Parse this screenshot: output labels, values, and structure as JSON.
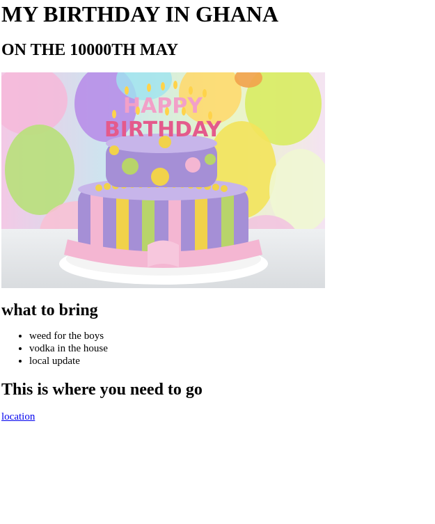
{
  "header": {
    "title": "MY BIRTHDAY IN GHANA",
    "subtitle": "ON THE 10000TH MAY"
  },
  "hero": {
    "icon": "birthday-cake-photo",
    "cake_text_top": "HAPPY",
    "cake_text_bottom": "BIRTHDAY"
  },
  "bring": {
    "heading": "what to bring",
    "items": [
      "weed for the boys",
      "vodka in the house",
      "local update"
    ]
  },
  "directions": {
    "heading": "This is where you need to go",
    "link_label": "location"
  },
  "colors": {
    "link": "#0000ee",
    "cake_purple": "#a58fd6",
    "cake_pink": "#f4b6d2",
    "cake_yellow": "#f1d24a",
    "cake_green": "#b8d46a"
  }
}
